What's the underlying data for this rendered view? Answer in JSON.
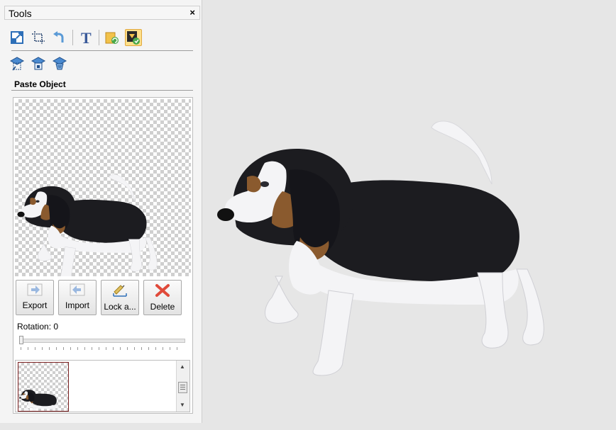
{
  "panel": {
    "title": "Tools",
    "close_glyph": "×",
    "toolbar_top": [
      {
        "name": "resize-icon"
      },
      {
        "name": "crop-icon"
      },
      {
        "name": "undo-icon"
      },
      {
        "name": "text-icon"
      },
      {
        "name": "paste-image-icon"
      },
      {
        "name": "paste-object-icon",
        "active": true
      }
    ],
    "toolbar_second": [
      {
        "name": "object-tool-1-icon"
      },
      {
        "name": "object-tool-2-icon"
      },
      {
        "name": "object-tool-3-icon"
      }
    ],
    "section_title": "Paste Object",
    "buttons": {
      "export": "Export",
      "import": "Import",
      "lock": "Lock a...",
      "delete": "Delete"
    },
    "rotation_label": "Rotation:",
    "rotation_value": "0"
  },
  "colors": {
    "dog_black": "#1c1c20",
    "dog_white": "#f4f4f6",
    "dog_tan": "#8a5a2e",
    "delete_red": "#e04a3a",
    "accent": "#2d6fb8"
  }
}
